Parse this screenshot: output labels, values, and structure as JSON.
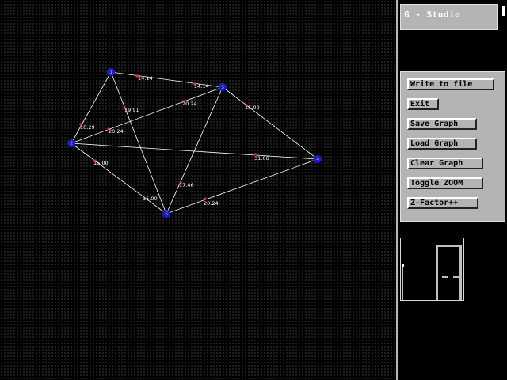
{
  "app": {
    "title": "G - Studio"
  },
  "buttons": {
    "write_to_file": "Write to file",
    "exit": "Exit",
    "save_graph": "Save Graph",
    "load_graph": "Load Graph",
    "clear_graph": "Clear Graph",
    "toggle_zoom": "Toggle ZOOM",
    "z_factor": "Z-Factor++"
  },
  "graph": {
    "colors": {
      "edge": "#ffffff",
      "node": "#1c1cc8",
      "edge_marker": "#ff2020",
      "background": "#000000"
    },
    "nodes": [
      {
        "id": "1",
        "label": "1"
      },
      {
        "id": "2",
        "label": "2"
      },
      {
        "id": "3",
        "label": "3"
      },
      {
        "id": "4",
        "label": "4"
      },
      {
        "id": "5",
        "label": "5"
      }
    ],
    "edges": [
      {
        "from": "1",
        "to": "3",
        "weight": "14.14"
      },
      {
        "from": "1",
        "to": "2",
        "weight": "10.29"
      },
      {
        "from": "1",
        "to": "5",
        "weight": "19.91"
      },
      {
        "from": "2",
        "to": "3",
        "weight": "20.24"
      },
      {
        "from": "2",
        "to": "4",
        "weight": "31.06"
      },
      {
        "from": "2",
        "to": "5",
        "weight": "15.00"
      },
      {
        "from": "3",
        "to": "4",
        "weight": "15.00"
      },
      {
        "from": "3",
        "to": "5",
        "weight": "17.46"
      },
      {
        "from": "5",
        "to": "4",
        "weight": "20.24"
      }
    ]
  }
}
